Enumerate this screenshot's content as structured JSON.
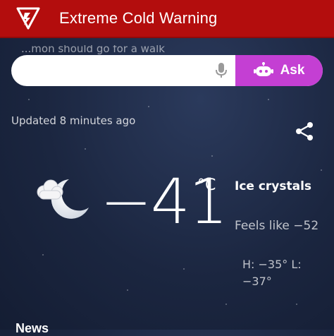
{
  "banner": {
    "title": "Extreme Cold Warning",
    "color": "#b30d0d"
  },
  "search": {
    "faded_hint": "...mon should go for a walk",
    "placeholder": "",
    "ask_label": "Ask",
    "ask_color": "#c43fd3",
    "mic_icon": "microphone-icon",
    "ask_icon": "robot-icon"
  },
  "status": {
    "updated": "Updated 8 minutes ago",
    "share_icon": "share-icon"
  },
  "current": {
    "icon": "partly-cloudy-night-icon",
    "temperature": "−41",
    "unit": "°C",
    "condition": "Ice crystals",
    "feels_like": "Feels like −52",
    "high": "H: −35°",
    "low": "L: −37°"
  },
  "sections": {
    "news": "News"
  }
}
